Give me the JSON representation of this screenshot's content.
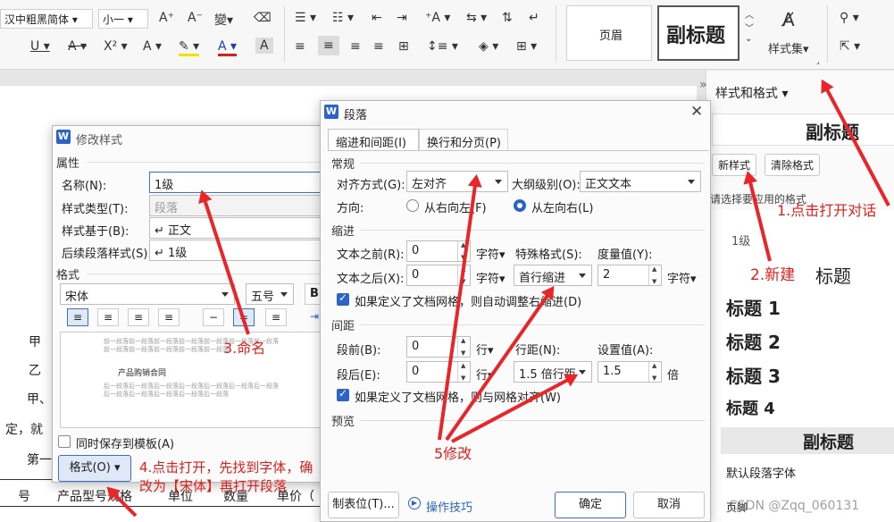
{
  "ribbon": {
    "font_name": "汉中粗黑简体",
    "font_size": "小一",
    "style_normal": "页眉",
    "style_subtitle": "副标题",
    "style_set": "样式集"
  },
  "doc": {
    "left_chars": [
      "甲",
      "乙",
      "甲、",
      "定，就",
      "第一"
    ],
    "table_headers": [
      "号",
      "产品型号规格",
      "单位",
      "数量",
      "单价（"
    ]
  },
  "panel": {
    "title": "样式和格式",
    "current": "副标题",
    "new_style": "新样式",
    "clear_format": "清除格式",
    "hint": "请选择要应用的格式",
    "styles": [
      "1级",
      "标题",
      "标题 1",
      "标题 2",
      "标题 3",
      "标题 4",
      "副标题",
      "默认段落字体",
      "页脚"
    ]
  },
  "modify": {
    "title": "修改样式",
    "attr_section": "属性",
    "name_label": "名称(N):",
    "name_value": "1级",
    "type_label": "样式类型(T):",
    "type_value": "段落",
    "based_label": "样式基于(B):",
    "based_value": "↵ 正文",
    "next_label": "后续段落样式(S):",
    "next_value": "↵ 1级",
    "format_section": "格式",
    "font_value": "宋体",
    "size_value": "五号",
    "preview_before": "前一段落前一段落前一段落前一段落前一段落前一段落前一段落前一段落前一段落前一段落前一段落前一段落",
    "preview_sample": "产品购销合同",
    "preview_after": "后一段落后一段落后一段落后一段落后一段落后一段落后一段落后一段落后一段落后一段落后一段落后一段落",
    "save_template": "同时保存到模板(A)",
    "format_button": "格式(O)"
  },
  "para": {
    "title": "段落",
    "tab1": "缩进和间距(I)",
    "tab2": "换行和分页(P)",
    "general": "常规",
    "align_label": "对齐方式(G):",
    "align_value": "左对齐",
    "outline_label": "大纲级别(O):",
    "outline_value": "正文文本",
    "dir_label": "方向:",
    "rtl": "从右向左(F)",
    "ltr": "从左向右(L)",
    "indent": "缩进",
    "before_text_label": "文本之前(R):",
    "before_text_value": "0",
    "after_text_label": "文本之后(X):",
    "after_text_value": "0",
    "unit_char": "字符",
    "special_label": "特殊格式(S):",
    "special_value": "首行缩进",
    "measure_label": "度量值(Y):",
    "measure_value": "2",
    "grid_indent": "如果定义了文档网格，则自动调整右缩进(D)",
    "spacing": "间距",
    "before_label": "段前(B):",
    "before_value": "0",
    "after_label": "段后(E):",
    "after_value": "0",
    "unit_line": "行",
    "line_label": "行距(N):",
    "line_value": "1.5 倍行距",
    "set_label": "设置值(A):",
    "set_value": "1.5",
    "unit_times": "倍",
    "grid_align": "如果定义了文档网格，则与网格对齐(W)",
    "preview": "预览",
    "tabs_button": "制表位(T)...",
    "tips": "操作技巧",
    "ok": "确定",
    "cancel": "取消"
  },
  "annotations": {
    "a1": "1.点击打开对话",
    "a2": "2.新建",
    "a3": "3.命名",
    "a4_line1": "4.点击打开，先找到字体，确",
    "a4_line2": "改为【宋体】再打开段落",
    "a5": "5修改"
  },
  "watermark": "CSDN @Zqq_060131"
}
